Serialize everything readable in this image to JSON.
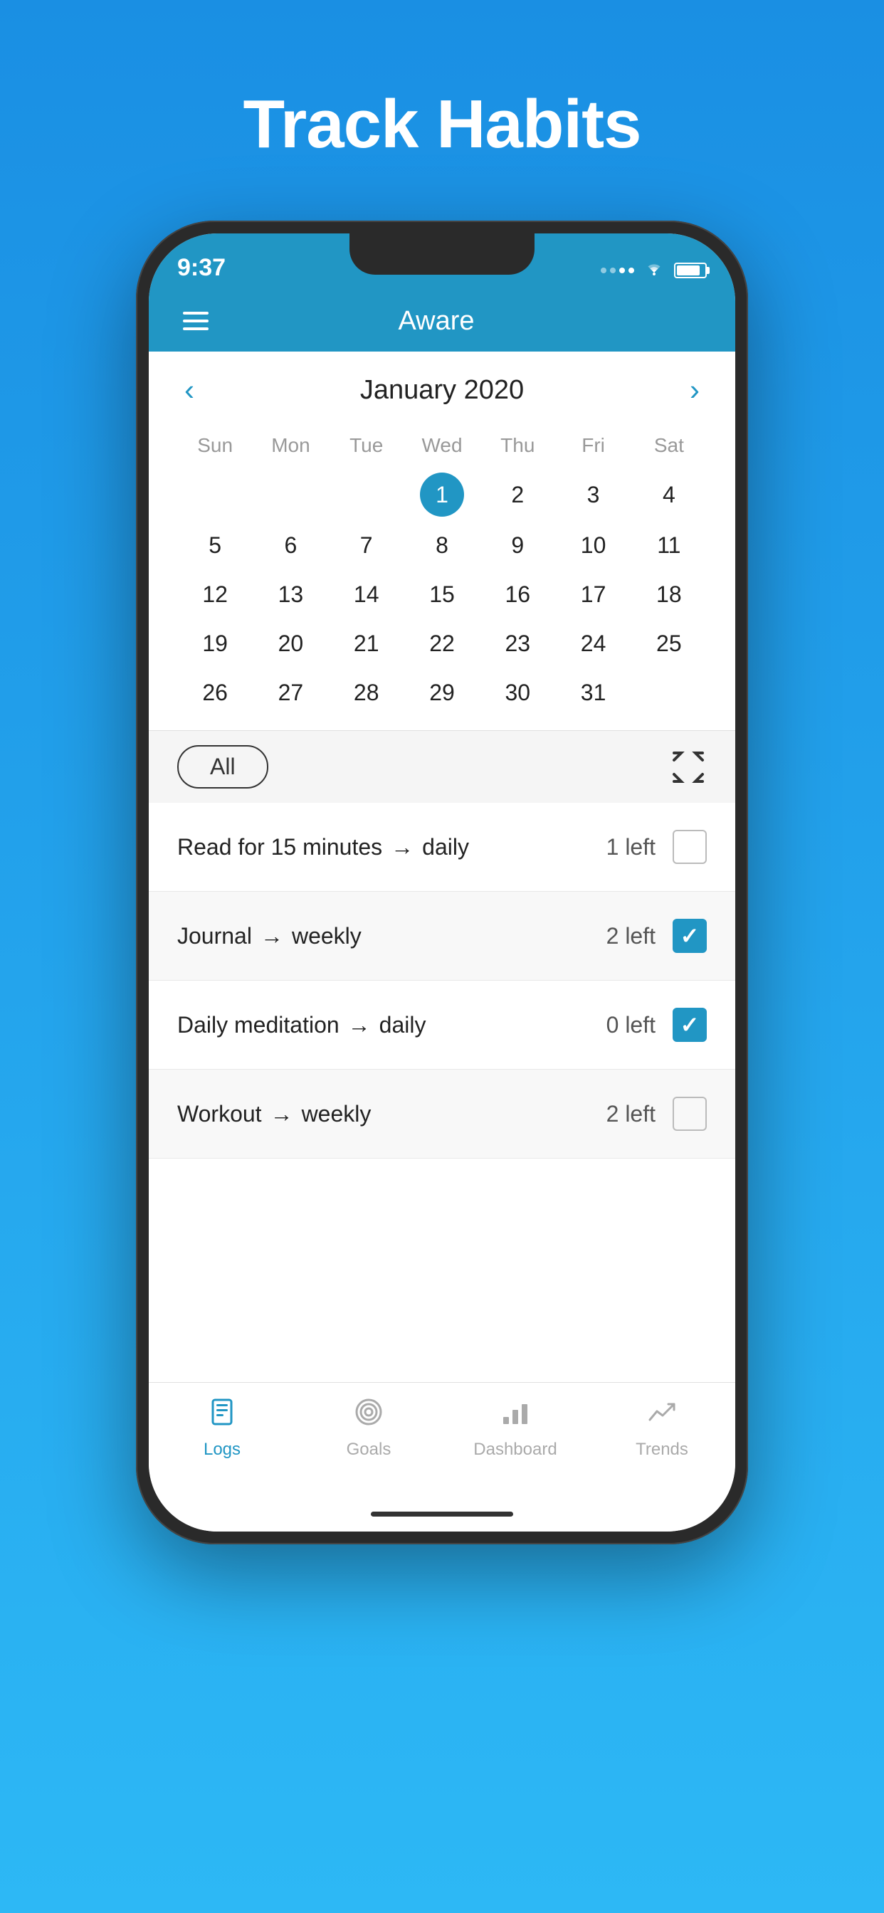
{
  "page": {
    "title": "Track Habits",
    "background_top": "#1a8fe3",
    "background_bottom": "#2db8f5"
  },
  "status_bar": {
    "time": "9:37",
    "battery_level": "85"
  },
  "nav": {
    "title": "Aware",
    "hamburger_label": "Menu"
  },
  "calendar": {
    "month": "January 2020",
    "prev_label": "‹",
    "next_label": "›",
    "day_names": [
      "Sun",
      "Mon",
      "Tue",
      "Wed",
      "Thu",
      "Fri",
      "Sat"
    ],
    "selected_day": 1,
    "weeks": [
      [
        null,
        null,
        null,
        1,
        2,
        3,
        4
      ],
      [
        5,
        6,
        7,
        8,
        9,
        10,
        11
      ],
      [
        12,
        13,
        14,
        15,
        16,
        17,
        18
      ],
      [
        19,
        20,
        21,
        22,
        23,
        24,
        25
      ],
      [
        26,
        27,
        28,
        29,
        30,
        31,
        null
      ]
    ]
  },
  "filter": {
    "label": "All"
  },
  "habits": [
    {
      "name": "Read for 15 minutes",
      "arrow": "→",
      "frequency": "daily",
      "count": "1 left",
      "checked": false
    },
    {
      "name": "Journal",
      "arrow": "→",
      "frequency": "weekly",
      "count": "2 left",
      "checked": true
    },
    {
      "name": "Daily meditation",
      "arrow": "→",
      "frequency": "daily",
      "count": "0 left",
      "checked": true
    },
    {
      "name": "Workout",
      "arrow": "→",
      "frequency": "weekly",
      "count": "2 left",
      "checked": false
    }
  ],
  "tabs": [
    {
      "id": "logs",
      "label": "Logs",
      "icon": "📅",
      "active": true
    },
    {
      "id": "goals",
      "label": "Goals",
      "icon": "🎯",
      "active": false
    },
    {
      "id": "dashboard",
      "label": "Dashboard",
      "icon": "📊",
      "active": false
    },
    {
      "id": "trends",
      "label": "Trends",
      "icon": "📈",
      "active": false
    }
  ]
}
